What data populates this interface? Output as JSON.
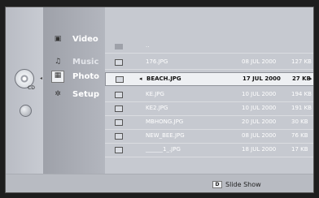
{
  "menu": {
    "disc_label": "CD",
    "items": [
      {
        "label": "Video",
        "icon": "video-icon"
      },
      {
        "label": "Music",
        "icon": "music-icon"
      },
      {
        "label": "Photo",
        "icon": "photo-icon"
      },
      {
        "label": "Setup",
        "icon": "setup-icon"
      }
    ]
  },
  "file_list": {
    "parent_dir": "..",
    "files": [
      {
        "name": "176.JPG",
        "date": "08 JUL 2000",
        "size": "127 KB"
      },
      {
        "name": "BEACH.JPG",
        "date": "17 JUL 2000",
        "size": "27 KB"
      },
      {
        "name": "KE.JPG",
        "date": "10 JUL 2000",
        "size": "194 KB"
      },
      {
        "name": "KE2.JPG",
        "date": "10 JUL 2000",
        "size": "191 KB"
      },
      {
        "name": "MBHONG.JPG",
        "date": "20 JUL 2000",
        "size": "30 KB"
      },
      {
        "name": "NEW_BEE.JPG",
        "date": "08 JUL 2000",
        "size": "76 KB"
      },
      {
        "name": "______1_.JPG",
        "date": "18 JUL 2000",
        "size": "17 KB"
      }
    ],
    "selected_index": 1
  },
  "footer": {
    "key": "D",
    "slideshow_label": "Slide Show"
  },
  "colors": {
    "panel": "#c6c9d0",
    "selected_row": "#eef0f3"
  }
}
